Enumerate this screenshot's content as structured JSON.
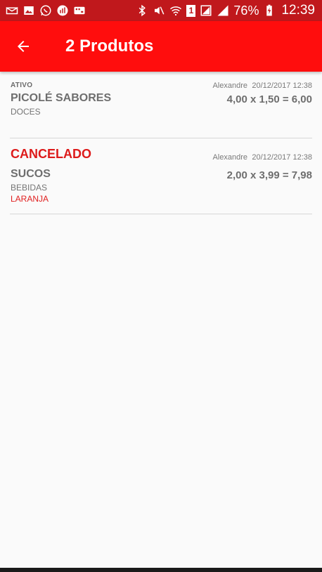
{
  "statusbar": {
    "battery_percent": "76%",
    "time": "12:39",
    "icons_left": [
      "mail-icon",
      "gallery-icon",
      "whatsapp-icon",
      "chart-icon",
      "keyboard-icon"
    ],
    "icons_right": [
      "bluetooth-icon",
      "mute-icon",
      "wifi-icon",
      "sim-icon",
      "signal-icon",
      "battery-icon"
    ],
    "sim_label": "1"
  },
  "appbar": {
    "title": "2 Produtos",
    "back_icon": "arrow-back-icon",
    "color": "#ff0d0d"
  },
  "items": [
    {
      "status": "ATIVO",
      "user": "Alexandre",
      "date": "20/12/2017 12:38",
      "name": "PICOLÉ SABORES",
      "category": "DOCES",
      "calc": "4,00 x 1,50 = 6,00"
    },
    {
      "status": "CANCELADO",
      "user": "Alexandre",
      "date": "20/12/2017 12:38",
      "name": "SUCOS",
      "category": "BEBIDAS",
      "extra": "LARANJA",
      "calc": "2,00 x 3,99 = 7,98"
    }
  ]
}
